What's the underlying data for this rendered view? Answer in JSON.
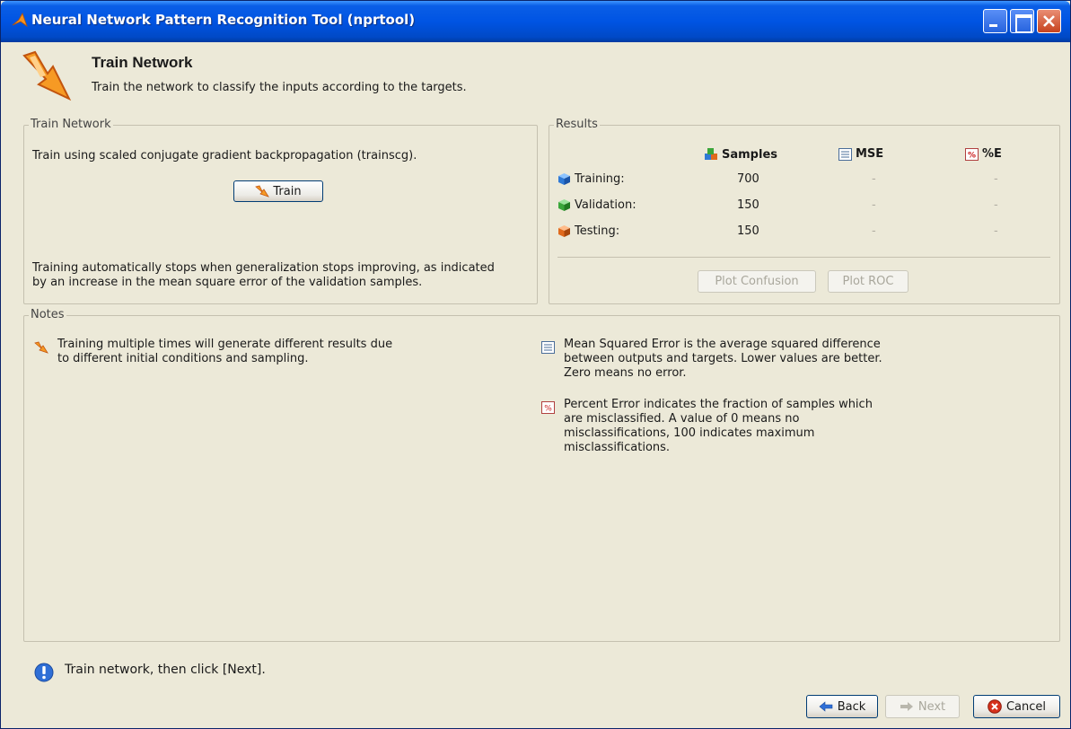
{
  "window": {
    "title": "Neural Network Pattern Recognition Tool (nprtool)"
  },
  "header": {
    "title": "Train Network",
    "subtitle": "Train the network to classify the inputs according to the targets."
  },
  "train_panel": {
    "legend": "Train Network",
    "description": "Train using scaled conjugate gradient backpropagation (trainscg).",
    "train_button": "Train",
    "note_line1": "Training automatically stops when generalization stops improving, as indicated",
    "note_line2": "by an increase in the mean square error of the validation samples."
  },
  "results_panel": {
    "legend": "Results",
    "columns": {
      "samples": "Samples",
      "mse": "MSE",
      "percent_error": "%E"
    },
    "rows": [
      {
        "label": "Training:",
        "samples": "700",
        "mse": "-",
        "percent_error": "-",
        "icon": "blue-cube-icon"
      },
      {
        "label": "Validation:",
        "samples": "150",
        "mse": "-",
        "percent_error": "-",
        "icon": "green-cube-icon"
      },
      {
        "label": "Testing:",
        "samples": "150",
        "mse": "-",
        "percent_error": "-",
        "icon": "orange-cube-icon"
      }
    ],
    "plot_confusion_button": "Plot Confusion",
    "plot_roc_button": "Plot ROC"
  },
  "notes_panel": {
    "legend": "Notes",
    "left_note": {
      "line1": "Training multiple times will generate different results due",
      "line2": "to different initial conditions and sampling."
    },
    "mse_note": {
      "line1": "Mean Squared Error is the average squared difference",
      "line2": "between outputs and targets. Lower values are better.",
      "line3": "Zero means no error."
    },
    "pe_note": {
      "line1": "Percent Error  indicates the fraction of samples which",
      "line2": "are misclassified. A value of 0 means no",
      "line3": "misclassifications, 100 indicates maximum",
      "line4": "misclassifications."
    }
  },
  "status": {
    "message": "Train network, then click [Next]."
  },
  "navigation": {
    "back": "Back",
    "next": "Next",
    "cancel": "Cancel"
  },
  "colors": {
    "title_bar": "#0054e3",
    "panel_background": "#ece9d8",
    "accent_orange": "#f59b1d",
    "info_blue": "#2f6fd6"
  }
}
